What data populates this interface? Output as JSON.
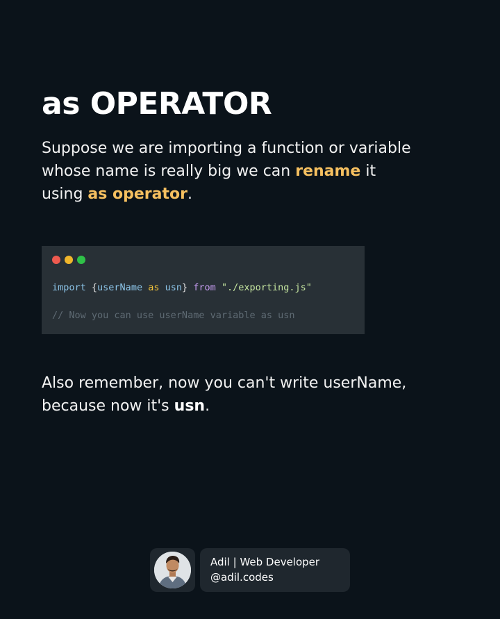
{
  "title": "as OPERATOR",
  "intro": {
    "part1": "Suppose we are importing a function or variable whose name is really big we can ",
    "highlight1": "rename",
    "part2": " it using ",
    "highlight2": "as operator",
    "part3": "."
  },
  "code": {
    "window_dots": [
      "#ee5a4f",
      "#f0b62b",
      "#2fc148"
    ],
    "line1": {
      "kw_import": "import",
      "brace_open": " {",
      "ident": "userName",
      "kw_as": " as ",
      "alias": "usn",
      "brace_close": "} ",
      "kw_from": "from",
      "string": " \"./exporting.js\""
    },
    "line2": "// Now you can use userName variable as usn"
  },
  "outro": {
    "part1": "Also remember, now you can't write userName, because now it's ",
    "bold": "usn",
    "part2": "."
  },
  "author": {
    "name": "Adil | Web Developer",
    "handle": "@adil.codes"
  },
  "colors": {
    "background": "#0b131a",
    "highlight": "#f6c060",
    "code_bg": "#283036",
    "card_bg": "#1f272e"
  }
}
